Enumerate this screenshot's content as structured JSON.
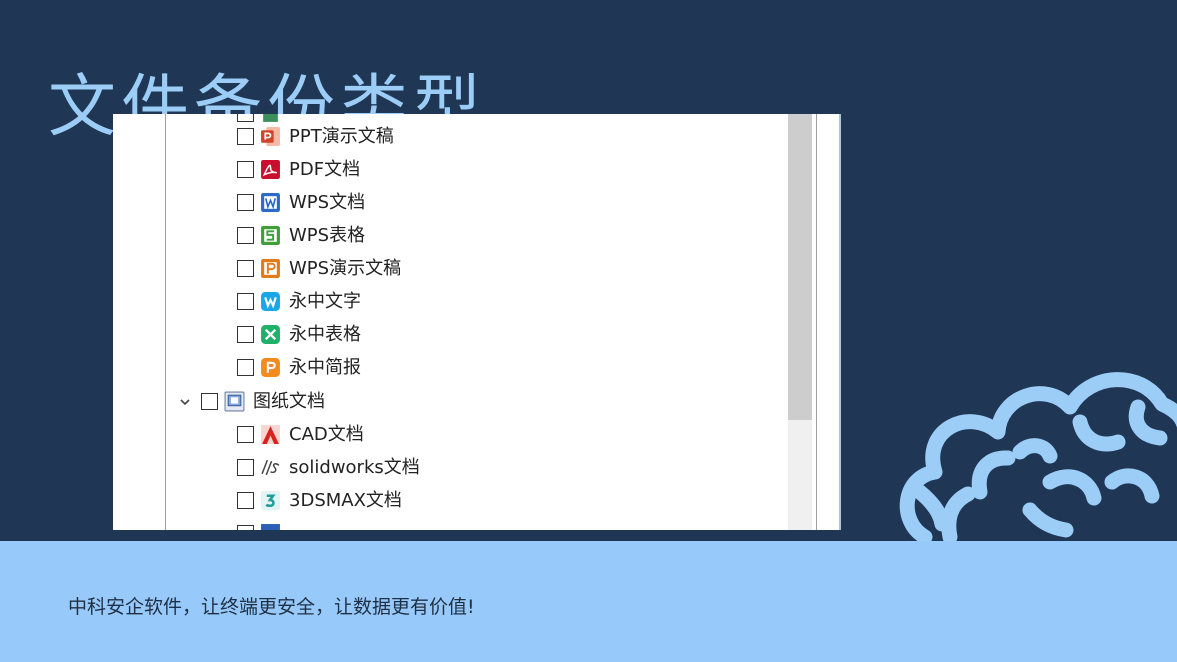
{
  "slide": {
    "title": "文件备份类型",
    "footer": "中科安企软件，让终端更安全，让数据更有价值!"
  },
  "tree": {
    "items": [
      {
        "label": "PPT演示文稿",
        "icon": "ppt-icon",
        "checked": false
      },
      {
        "label": "PDF文档",
        "icon": "pdf-icon",
        "checked": false
      },
      {
        "label": "WPS文档",
        "icon": "wps-writer-icon",
        "checked": false
      },
      {
        "label": "WPS表格",
        "icon": "wps-spreadsheet-icon",
        "checked": false
      },
      {
        "label": "WPS演示文稿",
        "icon": "wps-presentation-icon",
        "checked": false
      },
      {
        "label": "永中文字",
        "icon": "yozo-writer-icon",
        "checked": false
      },
      {
        "label": "永中表格",
        "icon": "yozo-spreadsheet-icon",
        "checked": false
      },
      {
        "label": "永中简报",
        "icon": "yozo-presentation-icon",
        "checked": false
      },
      {
        "label": "图纸文档",
        "icon": "drawing-folder-icon",
        "checked": false,
        "expanded": true
      },
      {
        "label": "CAD文档",
        "icon": "autocad-icon",
        "checked": false
      },
      {
        "label": "solidworks文档",
        "icon": "solidworks-icon",
        "checked": false
      },
      {
        "label": "3DSMAX文档",
        "icon": "3dsmax-icon",
        "checked": false
      }
    ]
  },
  "colors": {
    "background": "#1F3655",
    "title": "#9CCDF7",
    "footer_band": "#97CAFA",
    "brain": "#9CCDF7"
  },
  "icons": {
    "expander": "chevron-down-icon",
    "decoration": "brain-icon"
  }
}
